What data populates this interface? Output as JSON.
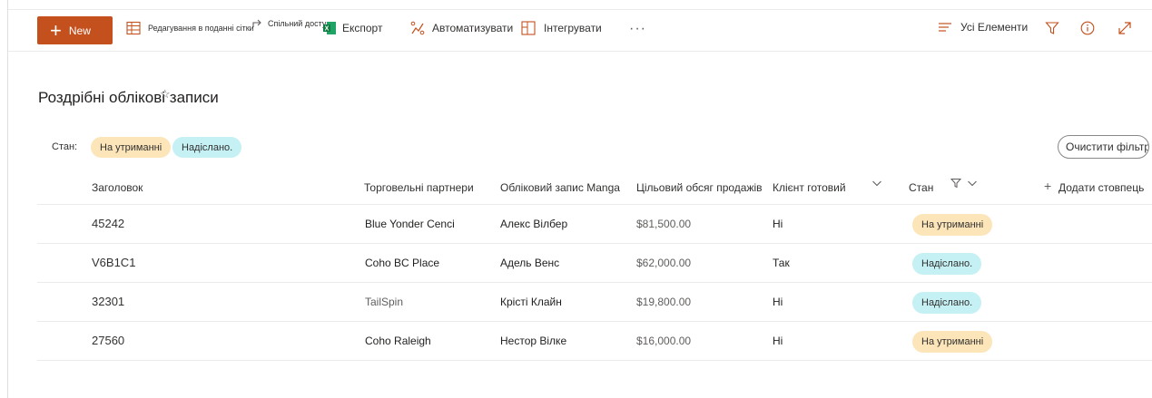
{
  "toolbar": {
    "new_label": "New",
    "edit_grid_label": "Редагування в поданні сітки",
    "share_label": "Спільний доступ",
    "export_label": "Експорт",
    "automate_label": "Автоматизувати",
    "integrate_label": "Інтегрувати",
    "more_label": "···",
    "view_label": "Усі Елементи"
  },
  "page": {
    "title": "Роздрібні облікові записи"
  },
  "filters": {
    "label": "Стан:",
    "chips": [
      "На утриманні",
      "Надіслано."
    ],
    "clear_label": "Очистити фільтри"
  },
  "table": {
    "columns": [
      "Заголовок",
      "Торговельні партнери",
      "Обліковий запис Manga",
      "Цільовий обсяг продажів",
      "Клієнт готовий",
      "Стан",
      "Додати стовпець"
    ],
    "rows": [
      {
        "title": "45242",
        "partner": "Blue Yonder Cenci",
        "account": "Алекс Вілбер",
        "target": "$81,500.00",
        "ready": "Ні",
        "status": "На утриманні",
        "status_kind": "hold"
      },
      {
        "title": "V6B1C1",
        "partner": "Coho BC Place",
        "account": "Адель Венс",
        "target": "$62,000.00",
        "ready": "Так",
        "status": "Надіслано.",
        "status_kind": "sent"
      },
      {
        "title": "32301",
        "partner": "TailSpin",
        "account": "Крісті Клайн",
        "target": "$19,800.00",
        "ready": "Ні",
        "status": "Надіслано.",
        "status_kind": "sent"
      },
      {
        "title": "27560",
        "partner": "Coho Raleigh",
        "account": "Нестор Вілке",
        "target": "$16,000.00",
        "ready": "Ні",
        "status": "На утриманні",
        "status_kind": "hold"
      }
    ]
  },
  "colors": {
    "accent": "#c4501e",
    "hold": "#fce5b9",
    "sent": "#c5f0f4"
  },
  "icons": [
    "plus-icon",
    "grid-edit-icon",
    "share-icon",
    "excel-icon",
    "automate-icon",
    "integrate-icon",
    "more-icon",
    "view-list-icon",
    "filter-icon",
    "info-icon",
    "expand-icon",
    "favorite-star-icon",
    "chevron-down-icon",
    "add-icon"
  ]
}
